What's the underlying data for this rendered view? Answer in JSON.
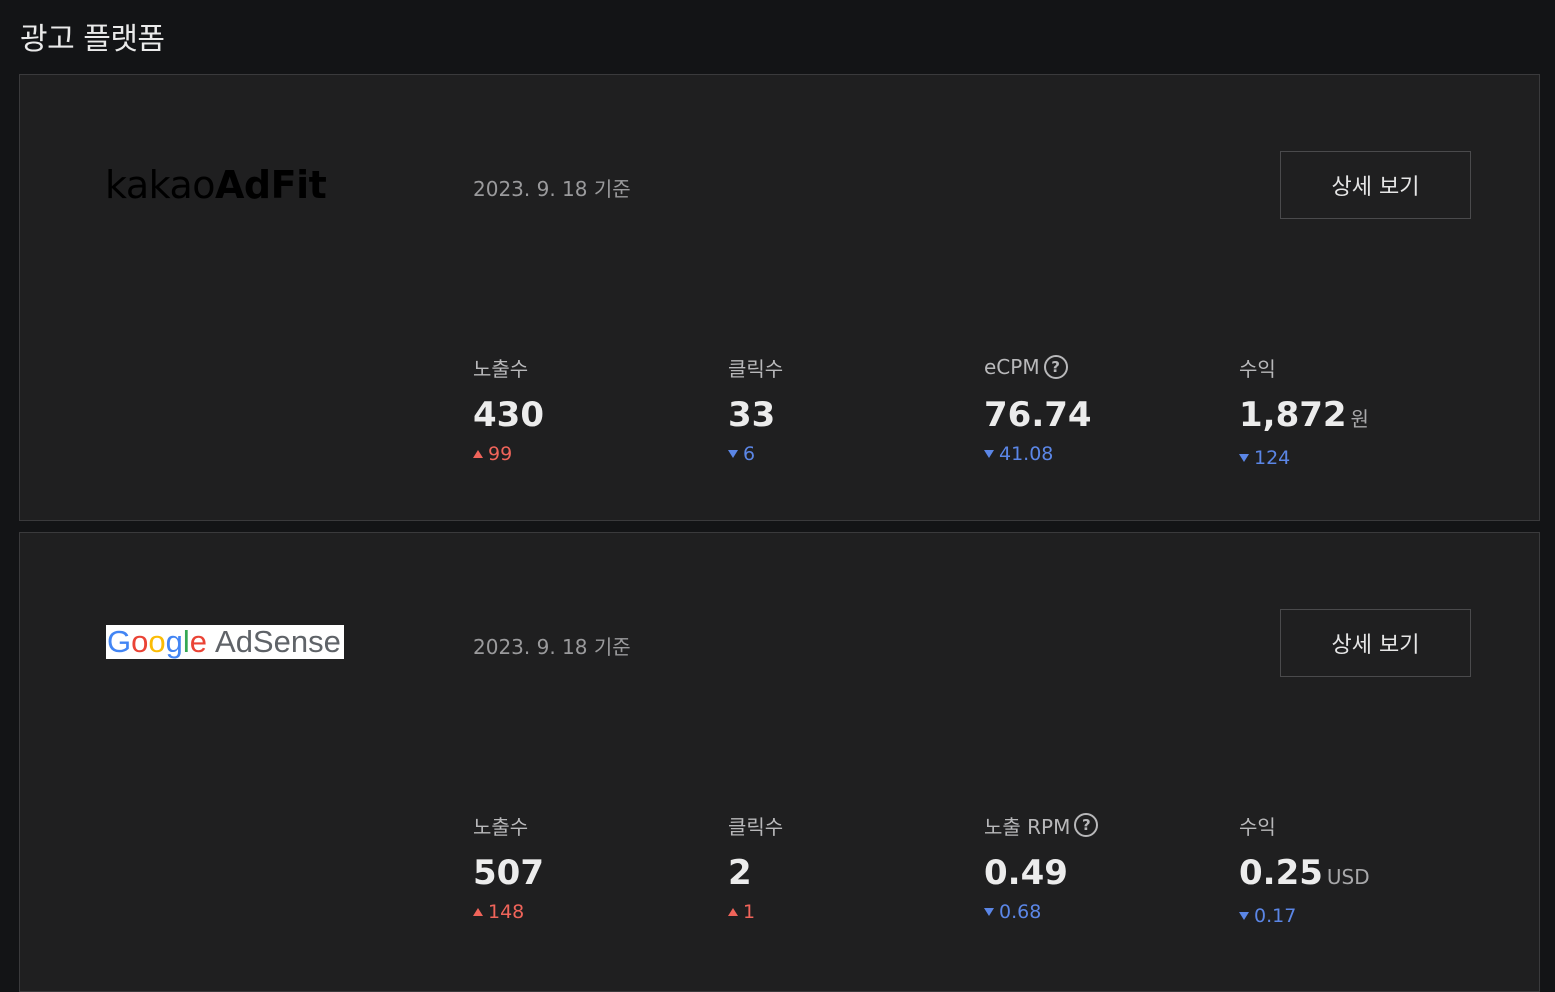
{
  "page": {
    "title": "광고 플랫폼"
  },
  "platforms": [
    {
      "logo_text_thin": "kakao",
      "logo_text_bold": "AdFit",
      "date": "2023. 9. 18 기준",
      "detail_label": "상세 보기",
      "metrics": [
        {
          "label": "노출수",
          "value": "430",
          "unit": "",
          "delta": "99",
          "direction": "up"
        },
        {
          "label": "클릭수",
          "value": "33",
          "unit": "",
          "delta": "6",
          "direction": "down"
        },
        {
          "label": "eCPM",
          "value": "76.74",
          "unit": "",
          "delta": "41.08",
          "direction": "down",
          "help_icon": "question-icon"
        },
        {
          "label": "수익",
          "value": "1,872",
          "unit": "원",
          "delta": "124",
          "direction": "down"
        }
      ]
    },
    {
      "logo_text_google": [
        "G",
        "o",
        "o",
        "g",
        "l",
        "e"
      ],
      "logo_text_product": "AdSense",
      "date": "2023. 9. 18 기준",
      "detail_label": "상세 보기",
      "metrics": [
        {
          "label": "노출수",
          "value": "507",
          "unit": "",
          "delta": "148",
          "direction": "up"
        },
        {
          "label": "클릭수",
          "value": "2",
          "unit": "",
          "delta": "1",
          "direction": "up"
        },
        {
          "label": "노출 RPM",
          "value": "0.49",
          "unit": "",
          "delta": "0.68",
          "direction": "down",
          "help_icon": "question-icon"
        },
        {
          "label": "수익",
          "value": "0.25",
          "unit": "USD",
          "delta": "0.17",
          "direction": "down"
        }
      ]
    }
  ],
  "help_icon_glyph": "?",
  "colors": {
    "up": "#f0645a",
    "down": "#5b86e6",
    "background": "#131416",
    "card": "#1f1f20"
  }
}
